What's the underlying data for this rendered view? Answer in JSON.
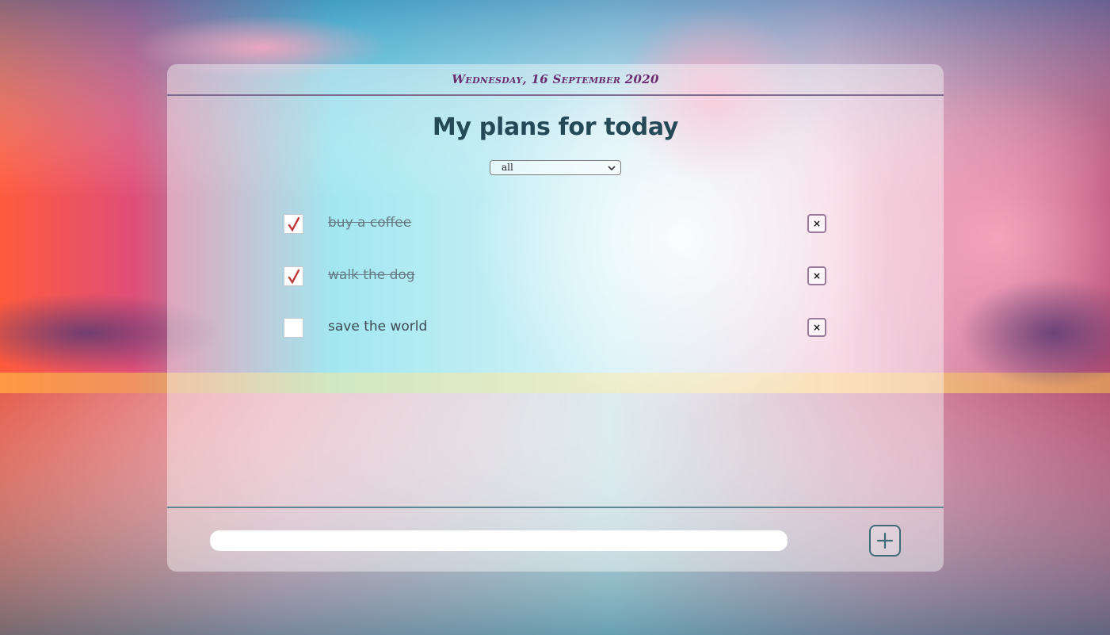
{
  "header": {
    "date": "Wednesday, 16 September 2020"
  },
  "title": "My plans for today",
  "filter": {
    "selected": "all"
  },
  "tasks": [
    {
      "label": "buy a coffee",
      "done": true,
      "delete_label": "×"
    },
    {
      "label": "walk the dog",
      "done": true,
      "delete_label": "×"
    },
    {
      "label": "save the world",
      "done": false,
      "delete_label": "×"
    }
  ],
  "new_task": {
    "value": "",
    "placeholder": ""
  },
  "icons": {
    "check": "check-icon",
    "add": "plus-icon",
    "delete": "close-icon",
    "dropdown": "chevron-down-icon"
  },
  "colors": {
    "title": "#254a57",
    "date": "#6a2d6e",
    "check": "#c0393b",
    "header_divider": "#7d6a8e",
    "footer_divider": "#5f8793"
  }
}
